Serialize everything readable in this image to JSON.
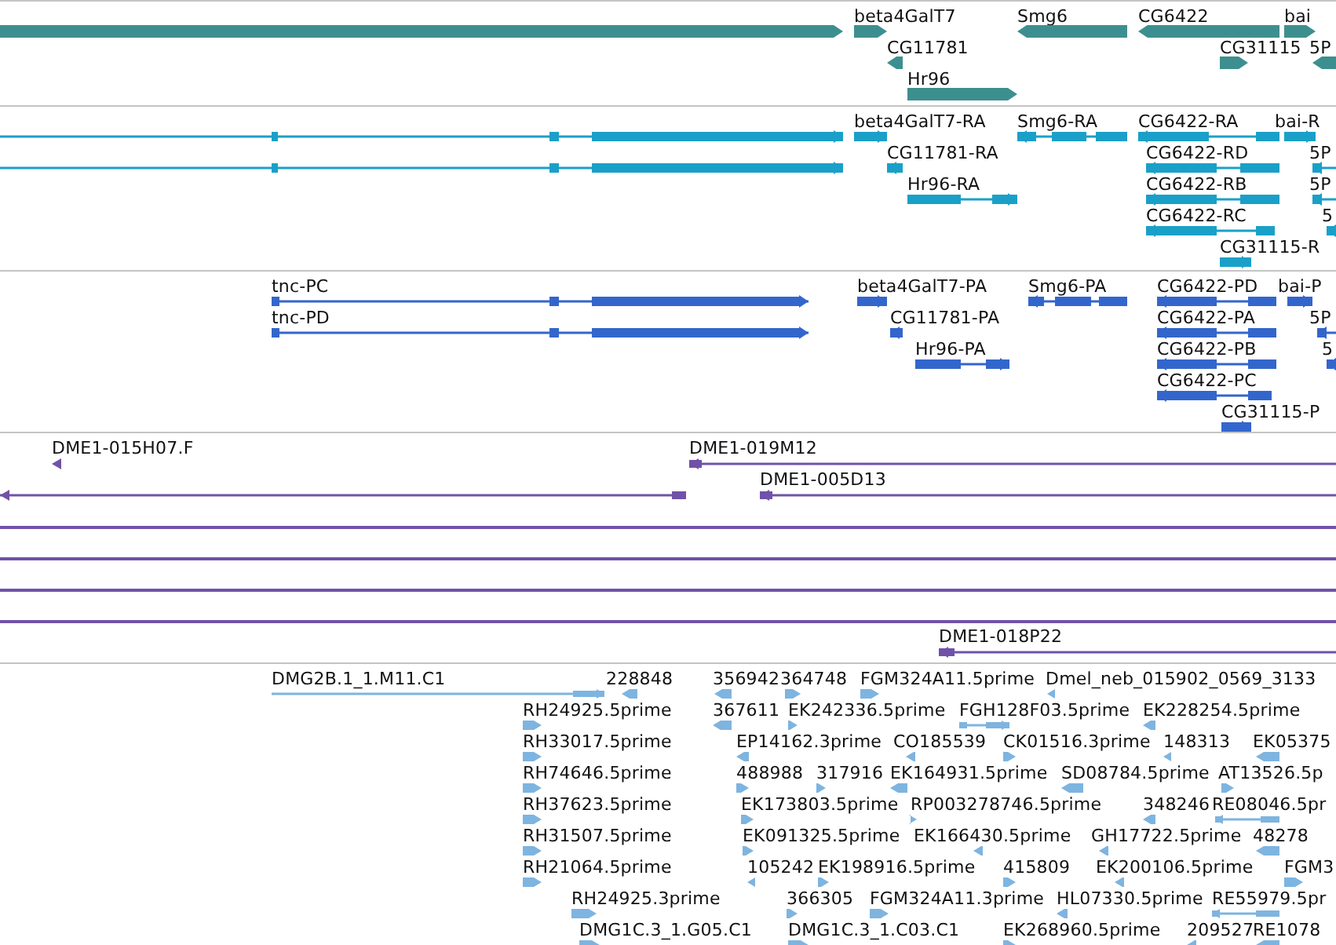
{
  "tracks": [
    {
      "color": "#3d8f8f",
      "features": [
        {
          "forward": true
        },
        {
          "label": "beta4GalT7",
          "forward": true
        },
        {
          "label": "Smg6",
          "forward": false
        },
        {
          "label": "CG6422",
          "forward": false
        },
        {
          "label": "bai",
          "forward": true
        },
        {
          "label": "CG11781",
          "forward": false
        },
        {
          "label": "CG31115",
          "forward": true
        },
        {
          "label": "5P",
          "forward": false
        },
        {
          "label": "Hr96",
          "forward": true
        }
      ]
    },
    {
      "color": "#1aa0c8",
      "features": [
        {
          "forward": true
        },
        {
          "forward": true
        },
        {
          "label": "beta4GalT7-RA",
          "forward": true
        },
        {
          "label": "Smg6-RA",
          "forward": false
        },
        {
          "label": "CG6422-RA",
          "forward": false
        },
        {
          "label": "bai-R",
          "forward": true
        },
        {
          "label": "CG11781-RA",
          "forward": false
        },
        {
          "label": "CG6422-RD",
          "forward": false
        },
        {
          "label": "5P",
          "forward": false
        },
        {
          "label": "Hr96-RA",
          "forward": true
        },
        {
          "label": "CG6422-RB",
          "forward": false
        },
        {
          "label": "5P",
          "forward": false
        },
        {
          "label": "CG6422-RC",
          "forward": false
        },
        {
          "label": "5",
          "forward": false
        },
        {
          "label": "CG31115-R",
          "forward": true
        }
      ]
    },
    {
      "color": "#3366cc",
      "features": [
        {
          "label": "tnc-PC",
          "forward": true
        },
        {
          "label": "tnc-PD",
          "forward": true
        },
        {
          "label": "beta4GalT7-PA",
          "forward": true
        },
        {
          "label": "Smg6-PA",
          "forward": false
        },
        {
          "label": "CG6422-PD",
          "forward": false
        },
        {
          "label": "bai-P",
          "forward": true
        },
        {
          "label": "CG11781-PA",
          "forward": false
        },
        {
          "label": "CG6422-PA",
          "forward": false
        },
        {
          "label": "5P",
          "forward": false
        },
        {
          "label": "Hr96-PA",
          "forward": true
        },
        {
          "label": "CG6422-PB",
          "forward": false
        },
        {
          "label": "5",
          "forward": false
        },
        {
          "label": "CG6422-PC",
          "forward": false
        },
        {
          "label": "CG31115-P",
          "forward": true
        }
      ]
    },
    {
      "color": "#7052a8",
      "features": [
        {
          "label": "DME1-015H07.F",
          "forward": false
        },
        {
          "label": "DME1-019M12",
          "forward": false
        },
        {
          "label": "DME1-005D13",
          "forward": false
        },
        {
          "forward": false
        },
        {
          "label": "DME1-018P22",
          "forward": false
        }
      ]
    },
    {
      "color": "#7eb4e0",
      "features": [
        {
          "label": "DMG2B.1_1.M11.C1",
          "forward": true
        },
        {
          "label": "228848",
          "forward": false
        },
        {
          "label": "356942",
          "forward": false
        },
        {
          "label": "364748",
          "forward": true
        },
        {
          "label": "FGM324A11.5prime",
          "forward": true
        },
        {
          "label": "Dmel_neb_015902_0569_3133",
          "forward": false
        },
        {
          "label": "RH24925.5prime",
          "forward": true
        },
        {
          "label": "367611",
          "forward": false
        },
        {
          "label": "EK242336.5prime",
          "forward": true
        },
        {
          "label": "FGH128F03.5prime",
          "forward": true
        },
        {
          "label": "EK228254.5prime",
          "forward": false
        },
        {
          "label": "RH33017.5prime",
          "forward": true
        },
        {
          "label": "EP14162.3prime",
          "forward": false
        },
        {
          "label": "CO185539",
          "forward": false
        },
        {
          "label": "CK01516.3prime",
          "forward": true
        },
        {
          "label": "148313",
          "forward": false
        },
        {
          "label": "EK05375",
          "forward": false
        },
        {
          "label": "RH74646.5prime",
          "forward": true
        },
        {
          "label": "488988",
          "forward": true
        },
        {
          "label": "317916",
          "forward": true
        },
        {
          "label": "EK164931.5prime",
          "forward": false
        },
        {
          "label": "SD08784.5prime",
          "forward": false
        },
        {
          "label": "AT13526.5p",
          "forward": true
        },
        {
          "label": "RH37623.5prime",
          "forward": true
        },
        {
          "label": "EK173803.5prime",
          "forward": true
        },
        {
          "label": "RP003278746.5prime",
          "forward": true
        },
        {
          "label": "348246",
          "forward": false
        },
        {
          "label": "RE08046.5pr",
          "forward": false
        },
        {
          "label": "RH31507.5prime",
          "forward": true
        },
        {
          "label": "EK091325.5prime",
          "forward": true
        },
        {
          "label": "EK166430.5prime",
          "forward": false
        },
        {
          "label": "GH17722.5prime",
          "forward": false
        },
        {
          "label": "48278",
          "forward": false
        },
        {
          "label": "RH21064.5prime",
          "forward": true
        },
        {
          "label": "105242",
          "forward": false
        },
        {
          "label": "EK198916.5prime",
          "forward": true
        },
        {
          "label": "415809",
          "forward": true
        },
        {
          "label": "EK200106.5prime",
          "forward": false
        },
        {
          "label": "FGM3",
          "forward": true
        },
        {
          "label": "RH24925.3prime",
          "forward": true
        },
        {
          "label": "366305",
          "forward": true
        },
        {
          "label": "FGM324A11.3prime",
          "forward": true
        },
        {
          "label": "HL07330.5prime",
          "forward": false
        },
        {
          "label": "RE55979.5pr",
          "forward": false
        },
        {
          "label": "DMG1C.3_1.G05.C1",
          "forward": true
        },
        {
          "label": "DMG1C.3_1.C03.C1",
          "forward": true
        },
        {
          "label": "EK268960.5prime",
          "forward": true
        },
        {
          "label": "209527",
          "forward": false
        },
        {
          "label": "RE1078",
          "forward": false
        }
      ]
    }
  ]
}
